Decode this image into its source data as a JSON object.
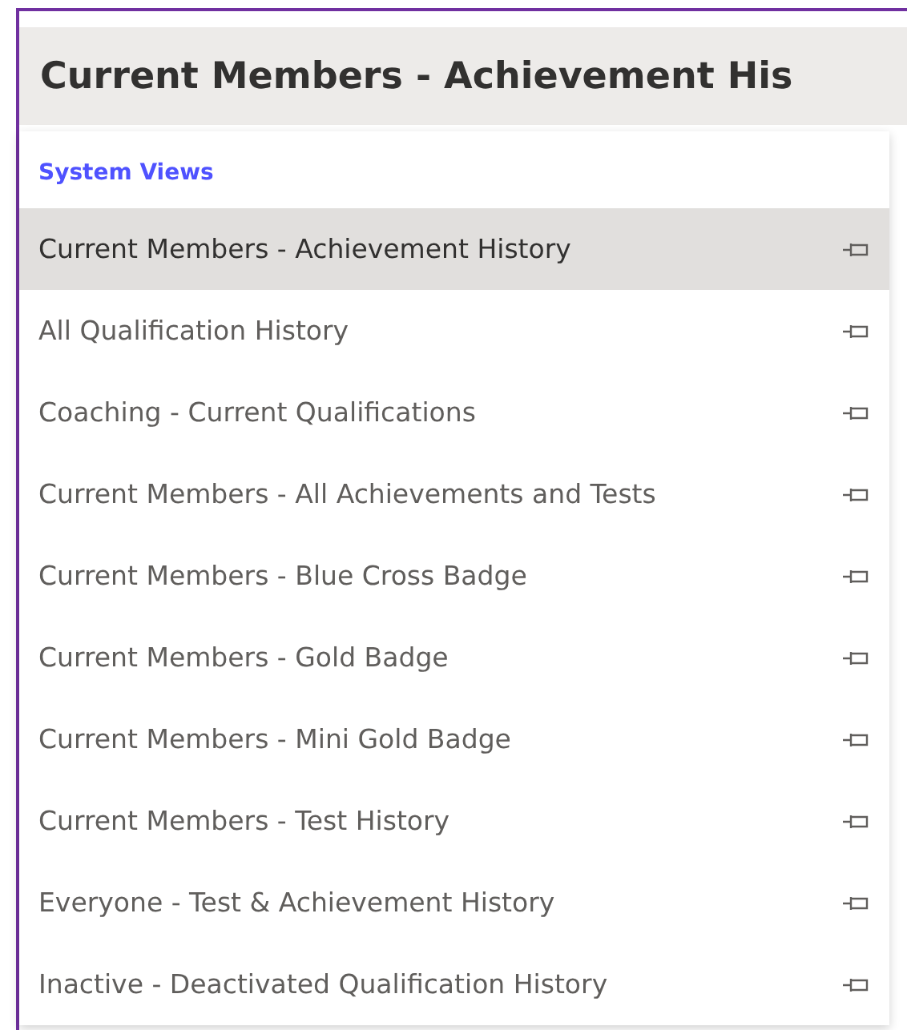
{
  "header": {
    "title": "Current Members - Achievement His"
  },
  "view_menu": {
    "section": "System Views",
    "items": [
      {
        "label": "Current Members - Achievement History",
        "selected": true
      },
      {
        "label": "All Qualification History",
        "selected": false
      },
      {
        "label": "Coaching - Current Qualifications",
        "selected": false
      },
      {
        "label": "Current Members - All Achievements and Tests",
        "selected": false
      },
      {
        "label": "Current Members - Blue Cross Badge",
        "selected": false
      },
      {
        "label": "Current Members - Gold Badge",
        "selected": false
      },
      {
        "label": "Current Members - Mini Gold Badge",
        "selected": false
      },
      {
        "label": "Current Members - Test History",
        "selected": false
      },
      {
        "label": "Everyone - Test & Achievement History",
        "selected": false
      },
      {
        "label": "Inactive - Deactivated Qualification History",
        "selected": false
      }
    ]
  }
}
